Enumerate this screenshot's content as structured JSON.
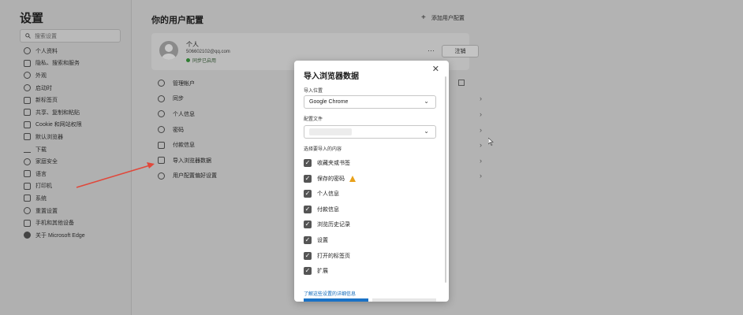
{
  "sidebar": {
    "title": "设置",
    "search_placeholder": "搜索设置",
    "items": [
      {
        "label": "个人资料",
        "icon": "profile-icon"
      },
      {
        "label": "隐私、搜索和服务",
        "icon": "lock-icon"
      },
      {
        "label": "外观",
        "icon": "appearance-icon"
      },
      {
        "label": "启动时",
        "icon": "power-icon"
      },
      {
        "label": "新标签页",
        "icon": "newtab-icon"
      },
      {
        "label": "共享、复制和粘贴",
        "icon": "share-icon"
      },
      {
        "label": "Cookie 和网站权限",
        "icon": "cookie-icon"
      },
      {
        "label": "默认浏览器",
        "icon": "browser-icon"
      },
      {
        "label": "下载",
        "icon": "download-icon"
      },
      {
        "label": "家庭安全",
        "icon": "family-icon"
      },
      {
        "label": "语言",
        "icon": "language-icon"
      },
      {
        "label": "打印机",
        "icon": "printer-icon"
      },
      {
        "label": "系统",
        "icon": "system-icon"
      },
      {
        "label": "重置设置",
        "icon": "reset-icon"
      },
      {
        "label": "手机和其他设备",
        "icon": "phone-icon"
      },
      {
        "label": "关于 Microsoft Edge",
        "icon": "edge-icon"
      }
    ]
  },
  "main": {
    "title": "你的用户配置",
    "add_profile": "添加用户配置",
    "profile": {
      "name": "个人",
      "email": "506602102@qq.com",
      "sync_status": "同步已启用",
      "more": "···",
      "signout": "注销"
    },
    "rows": [
      {
        "label": "管理帐户",
        "icon": "person-icon",
        "trail": "external-link-icon"
      },
      {
        "label": "同步",
        "icon": "sync-icon",
        "trail": "chevron-right-icon"
      },
      {
        "label": "个人信息",
        "icon": "contact-icon",
        "trail": "chevron-right-icon"
      },
      {
        "label": "密码",
        "icon": "key-icon",
        "trail": "chevron-right-icon"
      },
      {
        "label": "付款信息",
        "icon": "card-icon",
        "trail": "chevron-right-icon"
      },
      {
        "label": "导入浏览器数据",
        "icon": "import-icon",
        "trail": "chevron-right-icon"
      },
      {
        "label": "用户配置偏好设置",
        "icon": "prefs-icon",
        "trail": "chevron-right-icon"
      }
    ]
  },
  "dialog": {
    "title": "导入浏览器数据",
    "close": "✕",
    "import_from_label": "导入位置",
    "import_from_value": "Google Chrome",
    "profile_label": "配置文件",
    "choose_label": "选择要导入的内容",
    "items": [
      {
        "label": "收藏夹或书签",
        "checked": true,
        "warning": false
      },
      {
        "label": "保存的密码",
        "checked": true,
        "warning": true
      },
      {
        "label": "个人信息",
        "checked": true,
        "warning": false
      },
      {
        "label": "付款信息",
        "checked": true,
        "warning": false
      },
      {
        "label": "浏览历史记录",
        "checked": true,
        "warning": false
      },
      {
        "label": "设置",
        "checked": true,
        "warning": false
      },
      {
        "label": "打开的标签页",
        "checked": true,
        "warning": false
      },
      {
        "label": "扩展",
        "checked": true,
        "warning": false
      }
    ],
    "learn_more": "了解这些设置的详细信息"
  },
  "colors": {
    "overlay": "#b3b3b3",
    "checkbox": "#555555",
    "link": "#0b66b8",
    "primary_button": "#1a72c6",
    "annotation_arrow": "#e0483b"
  }
}
